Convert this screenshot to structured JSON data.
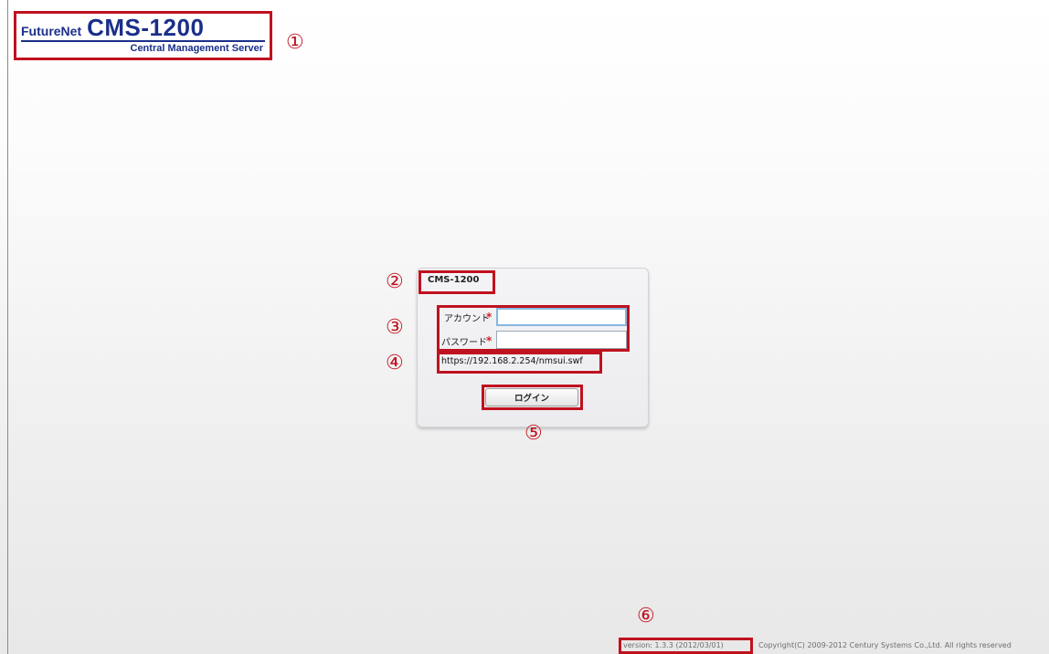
{
  "logo": {
    "brand": "FutureNet",
    "model": "CMS-1200",
    "subtitle": "Central Management Server"
  },
  "login": {
    "title": "CMS-1200",
    "account_label": "アカウント",
    "password_label": "パスワード",
    "required_mark": "*",
    "account_value": "",
    "password_value": "",
    "server_url": "https://192.168.2.254/nmsui.swf",
    "login_button": "ログイン"
  },
  "footer": {
    "version": "version: 1.3.3 (2012/03/01)",
    "copyright": "Copyright(C) 2009-2012 Century Systems Co.,Ltd. All rights reserved"
  },
  "annotations": [
    "①",
    "②",
    "③",
    "④",
    "⑤",
    "⑥"
  ],
  "colors": {
    "annotation_red": "#c0111f",
    "logo_blue": "#1a2f8a",
    "required_red": "#d0202a",
    "focus_blue": "#84b7e0"
  }
}
